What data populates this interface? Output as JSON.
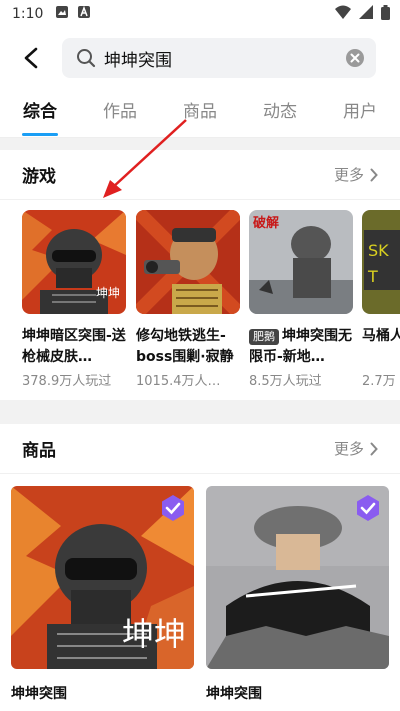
{
  "status": {
    "time": "1:10",
    "icons": [
      "image-icon",
      "a-icon"
    ],
    "right_icons": [
      "wifi-icon",
      "signal-icon",
      "battery-icon"
    ]
  },
  "search": {
    "query": "坤坤突围",
    "back_icon": "back-arrow-icon",
    "search_icon": "search-icon",
    "clear_icon": "clear-icon"
  },
  "tabs": [
    {
      "label": "综合",
      "active": true
    },
    {
      "label": "作品"
    },
    {
      "label": "商品"
    },
    {
      "label": "动态"
    },
    {
      "label": "用户"
    }
  ],
  "games_section": {
    "title": "游戏",
    "more": "更多",
    "items": [
      {
        "name": "坤坤暗区突围-送枪械皮肤…",
        "meta": "378.9万人玩过",
        "overlay": "坤坤"
      },
      {
        "name": "修勾地铁逃生-boss围剿·寂静",
        "meta": "1015.4万人…"
      },
      {
        "badge": "肥鹅",
        "name": "坤坤突围无限币-新地…",
        "meta": "8.5万人玩过",
        "overlay": "破解"
      },
      {
        "name": "马桶人变爆炸",
        "meta": "2.7万"
      }
    ]
  },
  "products_section": {
    "title": "商品",
    "more": "更多",
    "items": [
      {
        "name": "坤坤突围",
        "overlay": "坤坤"
      },
      {
        "name": "坤坤突围"
      }
    ]
  },
  "colors": {
    "accent": "#1a9ef5",
    "annotation_arrow": "#e02020"
  }
}
